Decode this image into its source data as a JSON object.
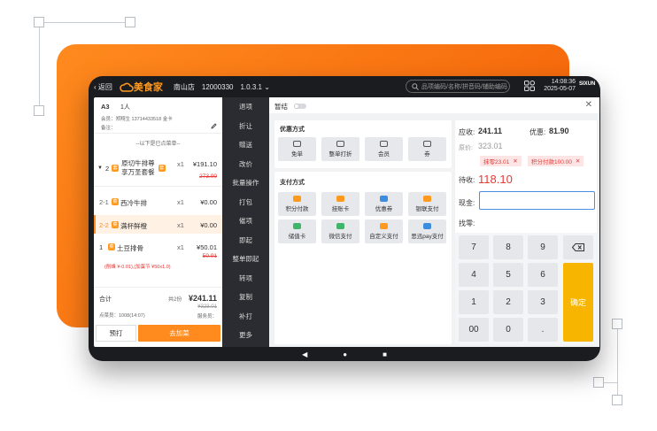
{
  "topbar": {
    "back": "返回",
    "logo": "美食家",
    "store": "南山店",
    "store_id": "12000330",
    "version": "1.0.3.1",
    "search_placeholder": "品项编码/名称/拼音码/辅助编码",
    "time": "14:08:36",
    "date": "2025-05-07",
    "brand": "SIXUN"
  },
  "order": {
    "table": "A3",
    "people": "1人",
    "member": "会员：郑翔生 13714433518 金卡",
    "remark": "备注：",
    "divider": "--以下是已点菜单--",
    "items": [
      {
        "idx": "2",
        "name1": "原切牛排尊",
        "name2": "享万圣套餐",
        "qty": "x1",
        "price": "¥191.10",
        "orig": "273.00"
      },
      {
        "idx": "2-1",
        "name": "西冷牛排",
        "qty": "x1",
        "price": "¥0.00"
      },
      {
        "idx": "2-2",
        "name": "满杯鲜橙",
        "qty": "x1",
        "price": "¥0.00"
      },
      {
        "idx": "1",
        "name": "土豆排骨",
        "qty": "x1",
        "price": "¥50.01",
        "orig": "50.01",
        "note": "(削峰 ¥-0.01),(加蛋节 ¥50x1.0)"
      }
    ],
    "total_label": "合计",
    "total_count": "共2份",
    "total": "¥241.11",
    "total_orig": "¥323.01",
    "order_no": "点菜员：1008(14:07)",
    "waiter": "服务员：",
    "preprint": "预打",
    "add": "去加菜"
  },
  "menu": [
    "退项",
    "折让",
    "赠送",
    "改价",
    "批量操作",
    "打包",
    "催项",
    "即起",
    "整单即起",
    "转项",
    "复制",
    "补打",
    "更多"
  ],
  "pay": {
    "hold": "暂结",
    "discount_title": "优惠方式",
    "discounts": [
      "免单",
      "整单打折",
      "会员",
      "券"
    ],
    "payment_title": "支付方式",
    "payments": [
      "积分付款",
      "挂账卡",
      "优惠券",
      "银联支付",
      "储值卡",
      "微信支付",
      "自定义支付",
      "思迅pay支付"
    ],
    "due_label": "应收:",
    "due": "241.11",
    "off_label": "优惠:",
    "off": "81.90",
    "orig_label": "原价:",
    "orig": "323.01",
    "tag1": "抹零23.01",
    "tag2": "积分付款100.00",
    "pending_label": "待收:",
    "pending": "118.10",
    "cash_label": "现金:",
    "change_label": "找零:",
    "keys": [
      "7",
      "8",
      "9",
      "4",
      "5",
      "6",
      "1",
      "2",
      "3",
      "00",
      "0",
      "."
    ],
    "confirm": "确定"
  },
  "colors": {
    "accent": "#ff8a1e",
    "red": "#e53935",
    "confirm": "#f7b500"
  }
}
